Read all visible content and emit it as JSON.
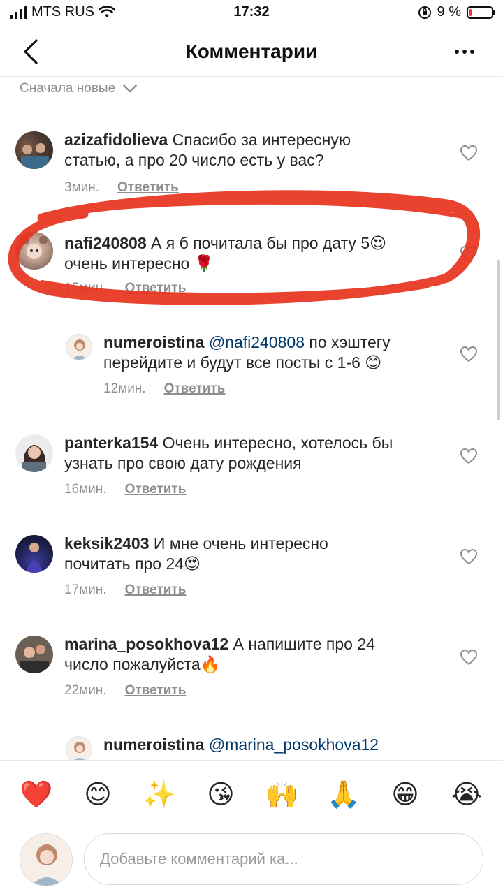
{
  "status_bar": {
    "carrier": "MTS RUS",
    "time": "17:32",
    "battery": "9 %",
    "battery_level": 0.09
  },
  "header": {
    "title": "Комментарии"
  },
  "sort": {
    "label": "Сначала новые"
  },
  "comments": [
    {
      "user": "azizafidolieva",
      "text": " Спасибо за интересную",
      "text2": "статью, а про 20 число есть у вас?",
      "time": "3мин.",
      "reply": "Ответить"
    },
    {
      "user": "nafi240808",
      "text": " А я б почитала бы про дату 5😍",
      "text2": "очень интересно 🌹",
      "time": "15мин.",
      "reply": "Ответить"
    },
    {
      "user": "numeroistina",
      "mention": "@nafi240808",
      "text": " по хэштегу",
      "text2": "перейдите и будут все посты с 1-6 😊",
      "time": "12мин.",
      "reply": "Ответить"
    },
    {
      "user": "panterka154",
      "text": " Очень интересно, хотелось бы",
      "text2": "узнать про свою дату рождения",
      "time": "16мин.",
      "reply": "Ответить"
    },
    {
      "user": "keksik2403",
      "text": " И мне очень интересно",
      "text2": "почитать про 24😍",
      "time": "17мин.",
      "reply": "Ответить"
    },
    {
      "user": "marina_posokhova12",
      "text": " А напишите про 24",
      "text2": "число пожалуйста🔥",
      "time": "22мин.",
      "reply": "Ответить"
    },
    {
      "user": "numeroistina",
      "mention": "@marina_posokhova12"
    }
  ],
  "emoji_bar": [
    "❤️",
    "😊",
    "✨",
    "😘",
    "🙌",
    "🙏",
    "😁",
    "😭"
  ],
  "composer": {
    "placeholder": "Добавьте комментарий ка..."
  },
  "colors": {
    "annotation": "#e8321e",
    "mention": "#00376b",
    "meta": "#8e8e8e"
  }
}
